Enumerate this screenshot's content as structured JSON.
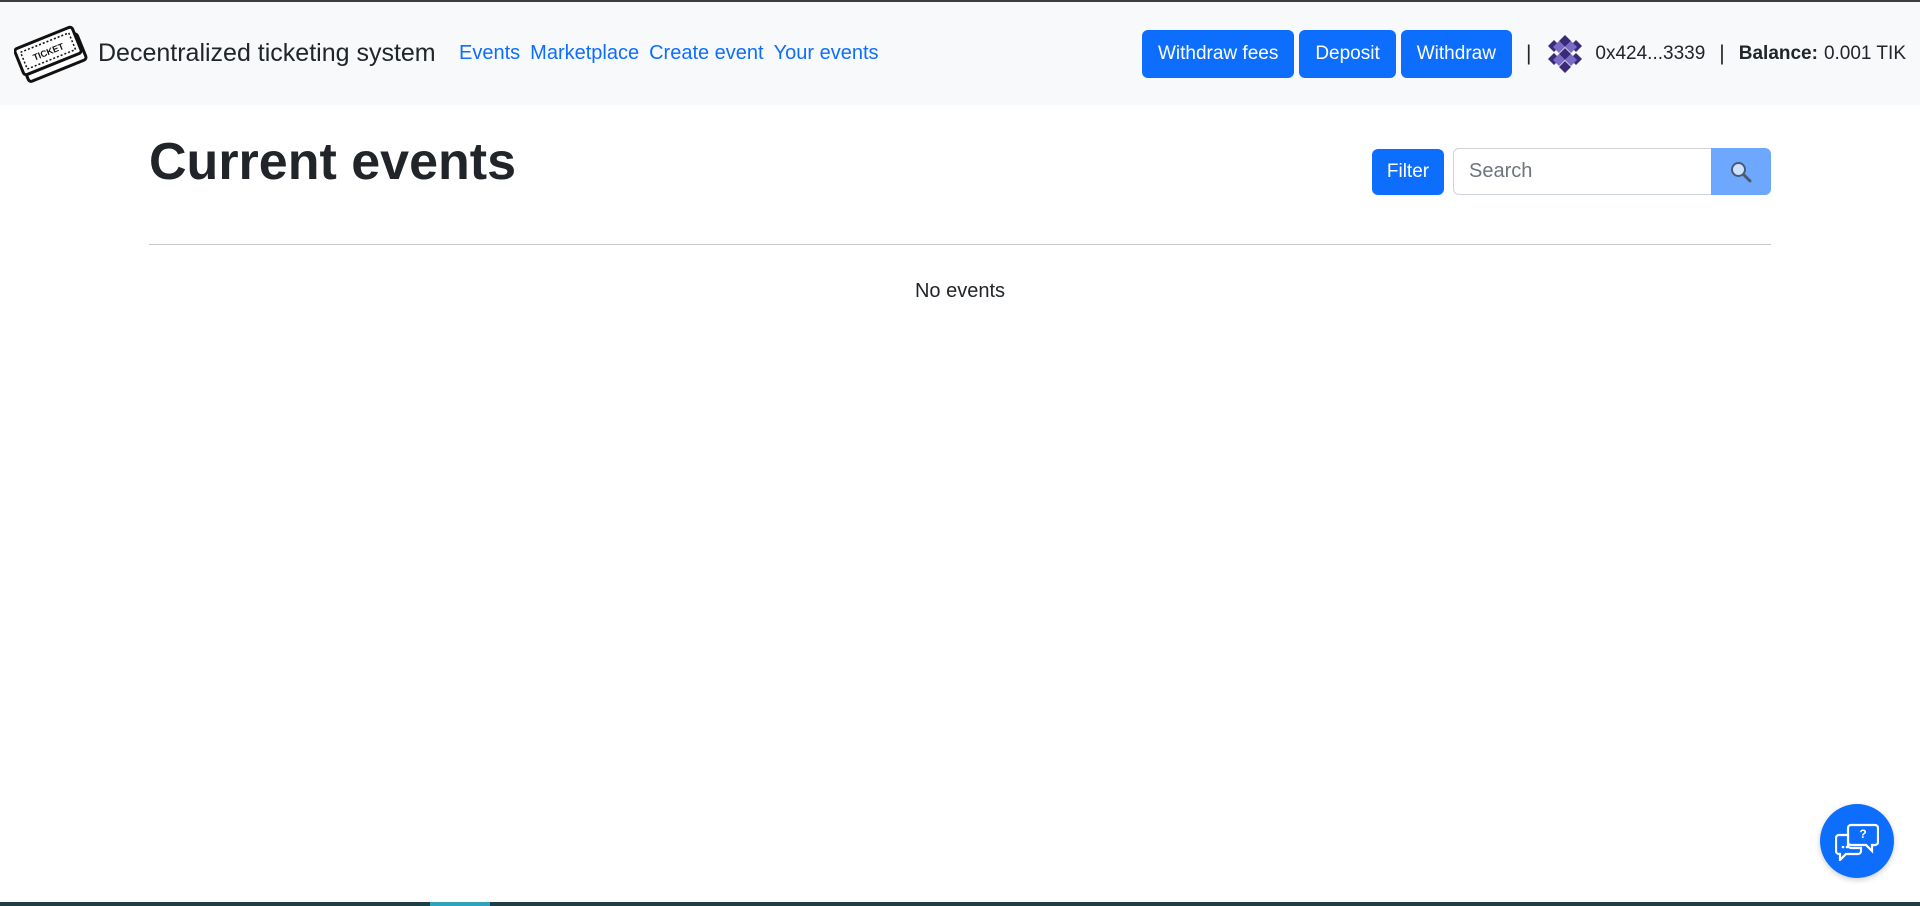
{
  "app": {
    "brand": "Decentralized ticketing system",
    "logo_icon": "ticket-icon",
    "logo_text": "TICKET"
  },
  "nav": {
    "links": [
      {
        "label": "Events"
      },
      {
        "label": "Marketplace"
      },
      {
        "label": "Create event"
      },
      {
        "label": "Your events"
      }
    ]
  },
  "account": {
    "buttons": {
      "withdraw_fees": "Withdraw fees",
      "deposit": "Deposit",
      "withdraw": "Withdraw"
    },
    "separator": "|",
    "avatar_icon": "identicon-avatar",
    "address": "0x424...3339",
    "balance_label": "Balance:",
    "balance_value": "0.001 TIK"
  },
  "main": {
    "title": "Current events",
    "filter_label": "Filter",
    "search": {
      "placeholder": "Search",
      "value": "",
      "icon": "search-icon"
    },
    "empty_message": "No events"
  },
  "help": {
    "icon": "help-chat-icon"
  },
  "colors": {
    "primary": "#0d6efd",
    "search_button": "#6ea8fe",
    "navbar_bg": "#f8f9fa",
    "avatar": "#3b2a7a"
  }
}
